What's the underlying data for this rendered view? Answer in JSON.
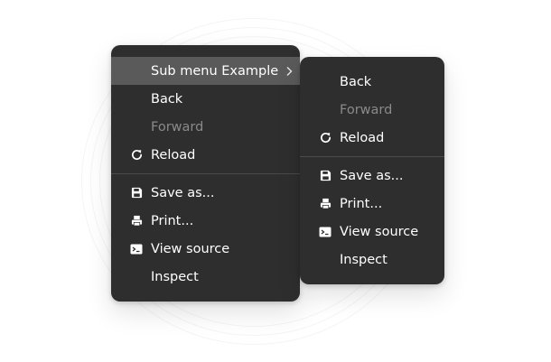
{
  "main_menu": {
    "items": [
      {
        "label": "Sub menu Example",
        "icon": "",
        "has_submenu": true,
        "highlighted": true
      },
      {
        "label": "Back",
        "icon": ""
      },
      {
        "label": "Forward",
        "icon": "",
        "disabled": true
      },
      {
        "label": "Reload",
        "icon": "reload-icon"
      },
      {
        "label": "Save as...",
        "icon": "save-icon"
      },
      {
        "label": "Print...",
        "icon": "print-icon"
      },
      {
        "label": "View source",
        "icon": "terminal-icon"
      },
      {
        "label": "Inspect",
        "icon": ""
      }
    ]
  },
  "sub_menu": {
    "items": [
      {
        "label": "Back",
        "icon": ""
      },
      {
        "label": "Forward",
        "icon": "",
        "disabled": true
      },
      {
        "label": "Reload",
        "icon": "reload-icon"
      },
      {
        "label": "Save as...",
        "icon": "save-icon"
      },
      {
        "label": "Print...",
        "icon": "print-icon"
      },
      {
        "label": "View source",
        "icon": "terminal-icon"
      },
      {
        "label": "Inspect",
        "icon": ""
      }
    ]
  },
  "colors": {
    "menu_background": "#2e2e2e",
    "highlight": "#5a5a5a",
    "text": "#ffffff",
    "disabled_text": "#8a8a8a",
    "separator": "#4a4a4a"
  }
}
